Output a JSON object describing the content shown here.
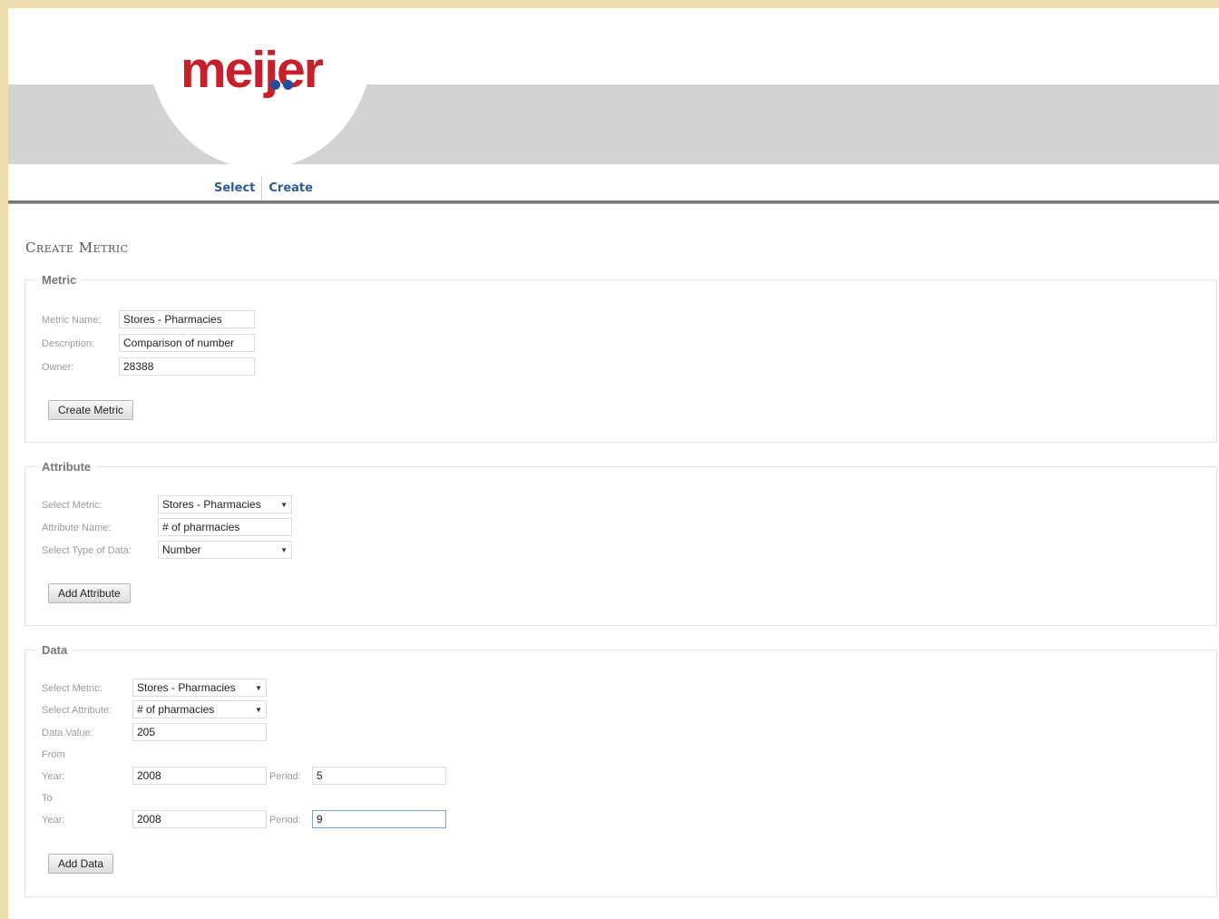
{
  "brand": {
    "logo_text": "meijer",
    "colors": {
      "brand_red": "#c8202a",
      "brand_blue": "#1f4f9d",
      "nav_link": "#2c5c92"
    }
  },
  "nav": {
    "items": [
      {
        "label": "Select"
      },
      {
        "label": "Create"
      }
    ]
  },
  "page": {
    "title": "Create Metric"
  },
  "metric": {
    "legend": "Metric",
    "name_label": "Metric Name:",
    "name_value": "Stores - Pharmacies",
    "description_label": "Description:",
    "description_value": "Comparison of number",
    "owner_label": "Owner:",
    "owner_value": "28388",
    "button_label": "Create Metric"
  },
  "attribute": {
    "legend": "Attribute",
    "select_metric_label": "Select Metric:",
    "select_metric_value": "Stores - Pharmacies",
    "name_label": "Attribute Name:",
    "name_value": "# of pharmacies",
    "type_label": "Select Type of Data:",
    "type_value": "Number",
    "button_label": "Add Attribute"
  },
  "data": {
    "legend": "Data",
    "select_metric_label": "Select Metric:",
    "select_metric_value": "Stores - Pharmacies",
    "select_attribute_label": "Select Attribute:",
    "select_attribute_value": "# of pharmacies",
    "value_label": "Data Value:",
    "value_value": "205",
    "from_label": "From",
    "from_year_label": "Year:",
    "from_year_value": "2008",
    "from_period_label": "Period:",
    "from_period_value": "5",
    "to_label": "To",
    "to_year_label": "Year:",
    "to_year_value": "2008",
    "to_period_label": "Period:",
    "to_period_value": "9",
    "button_label": "Add Data"
  }
}
